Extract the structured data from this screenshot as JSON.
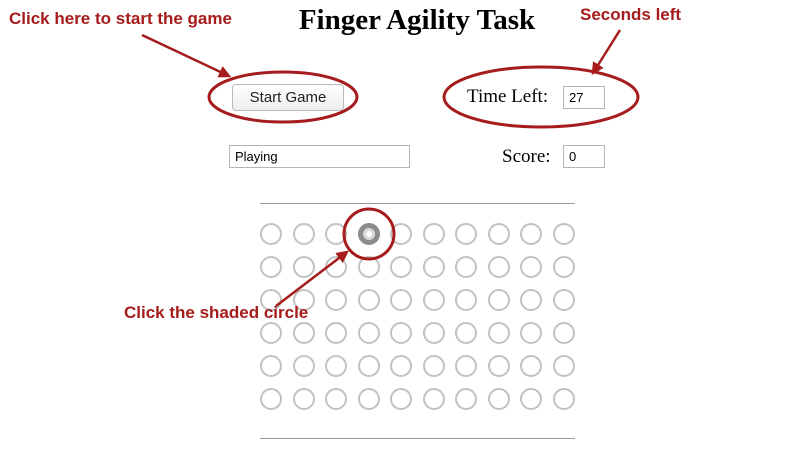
{
  "page": {
    "title": "Finger Agility Task"
  },
  "controls": {
    "start_label": "Start Game",
    "time_left_label": "Time Left:",
    "time_left_value": "27",
    "status_value": "Playing",
    "score_label": "Score:",
    "score_value": "0"
  },
  "grid": {
    "rows": 6,
    "cols": 10,
    "active_row": 0,
    "active_col": 3
  },
  "annotations": {
    "start_hint": "Click here to start the game",
    "seconds_hint": "Seconds left",
    "circle_hint": "Click the shaded circle",
    "color": "#a61c1c"
  }
}
